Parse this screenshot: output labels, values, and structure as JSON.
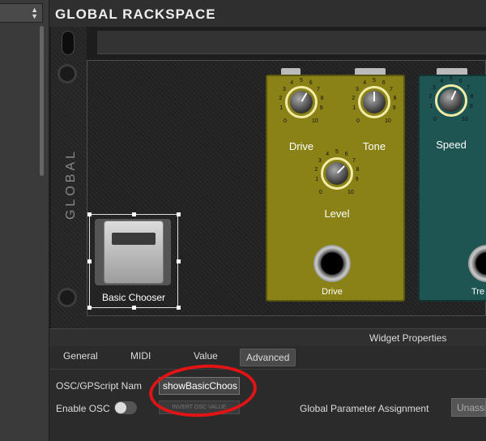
{
  "header": {
    "title": "GLOBAL RACKSPACE"
  },
  "rack": {
    "side_label": "GLOBAL"
  },
  "chooser": {
    "label": "Basic Chooser"
  },
  "pedal_overdrive": {
    "knobs": [
      {
        "label": "Drive",
        "min": "0",
        "max": "10"
      },
      {
        "label": "Tone",
        "min": "0",
        "max": "10"
      },
      {
        "label": "Level",
        "min": "0",
        "max": "10"
      }
    ],
    "jack_label": "Drive"
  },
  "pedal_tremolo": {
    "knobs": [
      {
        "label": "Speed",
        "min": "0",
        "max": "10"
      }
    ],
    "jack_label": "Tre"
  },
  "scale_ticks": [
    "1",
    "2",
    "3",
    "4",
    "5",
    "6",
    "7",
    "8",
    "9"
  ],
  "properties": {
    "title": "Widget Properties",
    "tabs": [
      "General",
      "MIDI",
      "Value",
      "Advanced"
    ],
    "active_tab": "Advanced",
    "osc_name_label": "OSC/GPScript Nam",
    "osc_name_value": "showBasicChoos",
    "enable_osc_label": "Enable OSC",
    "invert_osc_label": "INVERT OSC VALUE",
    "global_param_label": "Global Parameter Assignment",
    "global_param_value": "Unassi"
  },
  "colors": {
    "pedal_overdrive": "#8a8216",
    "pedal_tremolo": "#1e5452",
    "annotation": "#e01414"
  }
}
